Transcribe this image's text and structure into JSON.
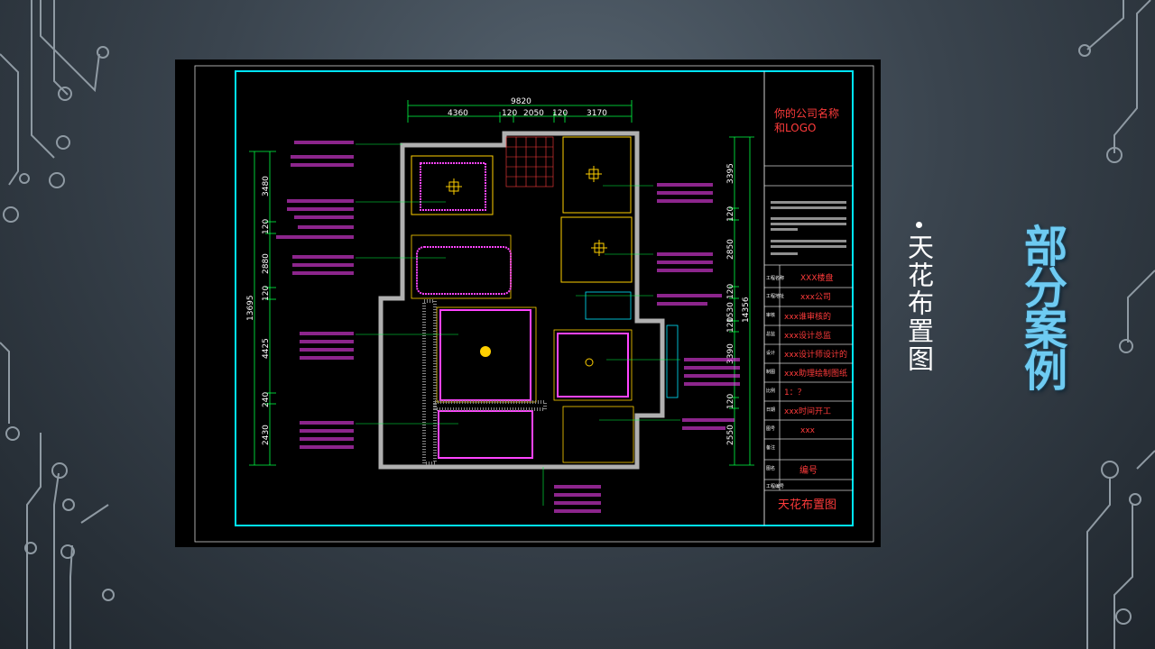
{
  "slide": {
    "title": "部分案例",
    "bullet": "天花布置图"
  },
  "drawing": {
    "dims_top": {
      "total": "9820",
      "parts": [
        "4360",
        "120",
        "2050",
        "120",
        "3170"
      ]
    },
    "dims_left": {
      "total": "13695",
      "parts": [
        "3480",
        "120",
        "2880",
        "120",
        "4425",
        "240",
        "2430"
      ]
    },
    "dims_right": {
      "total": "14356",
      "parts": [
        "3395",
        "120",
        "2850",
        "120",
        "1530",
        "120",
        "3390",
        "120",
        "2550"
      ]
    },
    "title_block": {
      "company": [
        "你的公司名称",
        "和LOGO"
      ],
      "rows": [
        {
          "label": "工程名称",
          "value": "XXX楼盘"
        },
        {
          "label": "工程地址",
          "value": "xxx公司"
        },
        {
          "label": "审核",
          "value": "xxx谁审核的"
        },
        {
          "label": "总监",
          "value": "xxx设计总监"
        },
        {
          "label": "设计",
          "value": "xxx设计师设计的"
        },
        {
          "label": "制图",
          "value": "xxx助理绘制图纸"
        },
        {
          "label": "比例",
          "value": "1：？"
        },
        {
          "label": "日期",
          "value": "xxx时间开工"
        },
        {
          "label": "图号",
          "value": "xxx"
        },
        {
          "label": "备注",
          "value": ""
        },
        {
          "label": "图名",
          "value": "编号"
        }
      ],
      "drawing_name_label": "工程编号",
      "drawing_name": "天花布置图"
    }
  },
  "colors": {
    "accent": "#6ecbf2",
    "cad_frame": "#00e5ff",
    "cad_red": "#ff3b3b",
    "cad_magenta": "#ff44ff",
    "cad_green": "#00ff44"
  }
}
